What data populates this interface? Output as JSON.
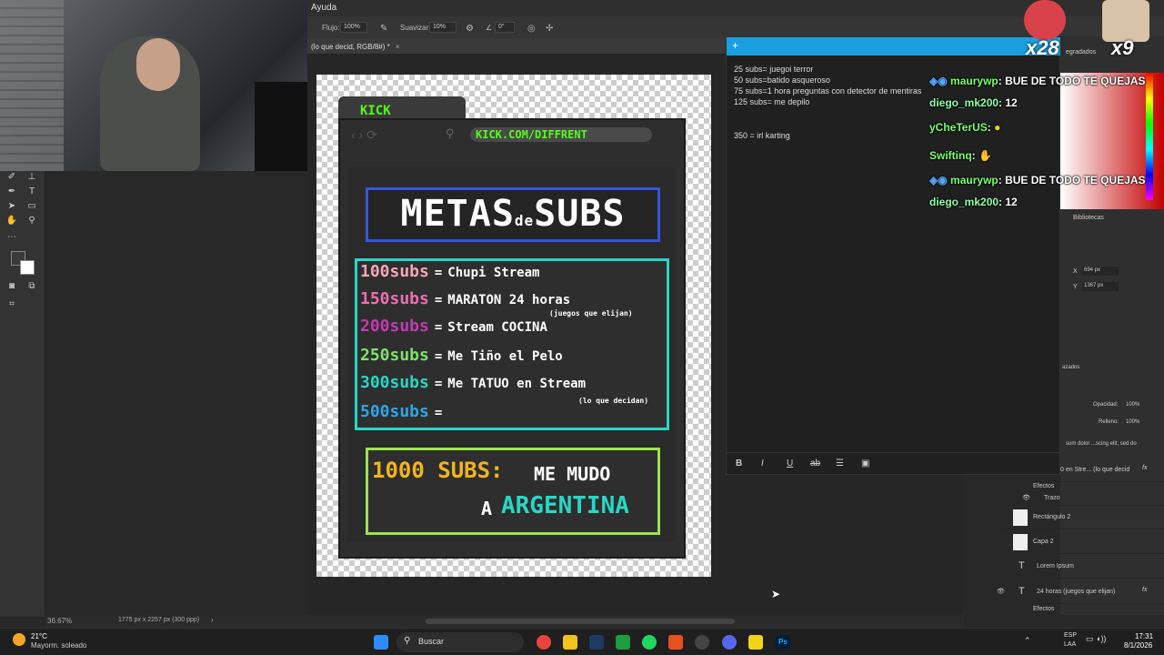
{
  "menubar": {
    "help": "Ayuda"
  },
  "options": {
    "flow_label": "Flujo:",
    "flow_value": "100%",
    "smooth_label": "Suavizar:",
    "smooth_value": "10%",
    "angle_value": "0°"
  },
  "document": {
    "tab_title": "(lo que decid, RGB/8#) *",
    "zoom": "36.67%",
    "dims": "1775 px x 2257 px (300 ppp)"
  },
  "poster": {
    "kick_tab": "KICK",
    "url": "KICK.COM/DIFFRENT",
    "title_a": "METAS",
    "title_de": "de",
    "title_b": "SUBS",
    "goals": [
      {
        "amount": "100subs",
        "eq": "=",
        "text": "Chupi Stream",
        "color": "#f7a6b4"
      },
      {
        "amount": "150subs",
        "eq": "=",
        "text": "MARATON 24 horas",
        "color": "#ee6fb0"
      },
      {
        "amount": "200subs",
        "eq": "=",
        "text": "Stream COCINA",
        "color": "#c23ab4"
      },
      {
        "amount": "250subs",
        "eq": "=",
        "text": "Me Tiño el Pelo",
        "color": "#7be36a"
      },
      {
        "amount": "300subs",
        "eq": "=",
        "text": "Me TATUO en Stream",
        "color": "#28d7c6"
      },
      {
        "amount": "500subs",
        "eq": "=",
        "text": "",
        "color": "#2fa6e8"
      }
    ],
    "note1": "(juegos que elijan)",
    "note2": "(lo que decidan)",
    "big_amount": "1000 SUBS:",
    "big_text1": "ME MUDO",
    "big_a": "A",
    "big_country": "ARGENTINA"
  },
  "notes": {
    "lines": [
      "25 subs= juegoi terror",
      "50 subs=batido asqueroso",
      "75 subs=1 hora preguntas con detector de mentiras",
      "125 subs= me depilo",
      "350 = irl karting"
    ]
  },
  "chat": [
    {
      "user": "maurywp",
      "msg": ": BUE DE TODO TE QUEJAS"
    },
    {
      "user": "diego_mk200",
      "msg": ": 12"
    },
    {
      "user": "yCheTerUS",
      "msg": ":"
    },
    {
      "user": "Swiftinq",
      "msg": ":"
    },
    {
      "user": "maurywp",
      "msg": ": BUE DE TODO TE QUEJAS"
    },
    {
      "user": "diego_mk200",
      "msg": ": 12"
    }
  ],
  "alerts": {
    "count_a": "x28",
    "count_b": "x9"
  },
  "panels": {
    "degradados": "egradados",
    "bibliotecas": "Bibliotecas",
    "x_label": "X",
    "x_value": "694 px",
    "y_label": "Y",
    "y_value": "1367 px",
    "opacity_label": "Opacidad:",
    "opacity_value": "100%",
    "fill_label": "Relleno:",
    "fill_value": "100%",
    "layer_frag": "sum dolor ...scing elit, sed do",
    "layers_label": "azados"
  },
  "layers": [
    {
      "name": "0 en Stre... (lo que decid"
    },
    {
      "name": "Efectos"
    },
    {
      "name": "Trazo"
    },
    {
      "name": "Rectángulo 2"
    },
    {
      "name": "Capa 2"
    },
    {
      "name": "Lorem Ipsum"
    },
    {
      "name": "24 horas (juegos que elijan)"
    },
    {
      "name": "Efectos"
    }
  ],
  "taskbar": {
    "weather_temp": "21°C",
    "weather_desc": "Mayorm. soleado",
    "search": "Buscar",
    "lang1": "ESP",
    "lang2": "LAA",
    "time": "17:31",
    "date": "8/1/2026"
  }
}
